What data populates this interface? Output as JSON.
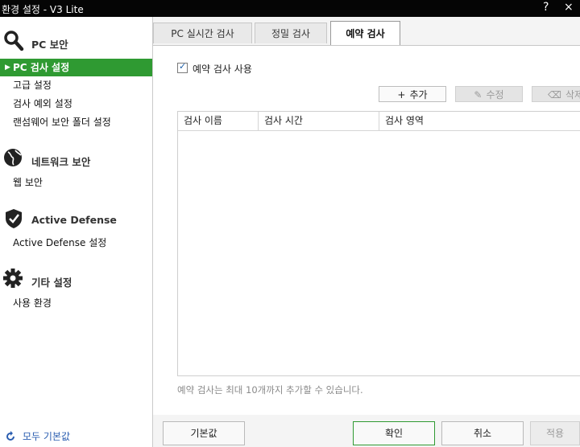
{
  "window": {
    "title": "환경 설정 - V3 Lite",
    "help_icon": "?",
    "close_icon": "×"
  },
  "sidebar": {
    "sections": [
      {
        "title": "PC 보안",
        "icon": "magnifier-icon",
        "items": [
          "PC 검사 설정",
          "고급 설정",
          "검사 예외 설정",
          "랜섬웨어 보안 폴더 설정"
        ]
      },
      {
        "title": "네트워크 보안",
        "icon": "globe-icon",
        "items": [
          "웹 보안"
        ]
      },
      {
        "title": "Active Defense",
        "icon": "shield-check-icon",
        "items": [
          "Active Defense 설정"
        ]
      },
      {
        "title": "기타 설정",
        "icon": "gear-icon",
        "items": [
          "사용 환경"
        ]
      }
    ],
    "active_item": "PC 검사 설정",
    "reset_all": "모두 기본값"
  },
  "tabs": [
    {
      "label": "PC 실시간 검사",
      "active": false
    },
    {
      "label": "정밀 검사",
      "active": false
    },
    {
      "label": "예약 검사",
      "active": true
    }
  ],
  "panel": {
    "enable_checkbox": {
      "label": "예약 검사 사용",
      "checked": true
    },
    "buttons": {
      "add": "추가",
      "edit": "수정",
      "delete": "삭제"
    },
    "table": {
      "columns": [
        "검사 이름",
        "검사 시간",
        "검사 영역"
      ],
      "rows": []
    },
    "note": "예약 검사는 최대 10개까지 추가할 수 있습니다."
  },
  "footer": {
    "default": "기본값",
    "ok": "확인",
    "cancel": "취소",
    "apply": "적용"
  },
  "colors": {
    "accent_green": "#2f9a32",
    "title_bar": "#050505",
    "link_blue": "#2a5db0"
  }
}
